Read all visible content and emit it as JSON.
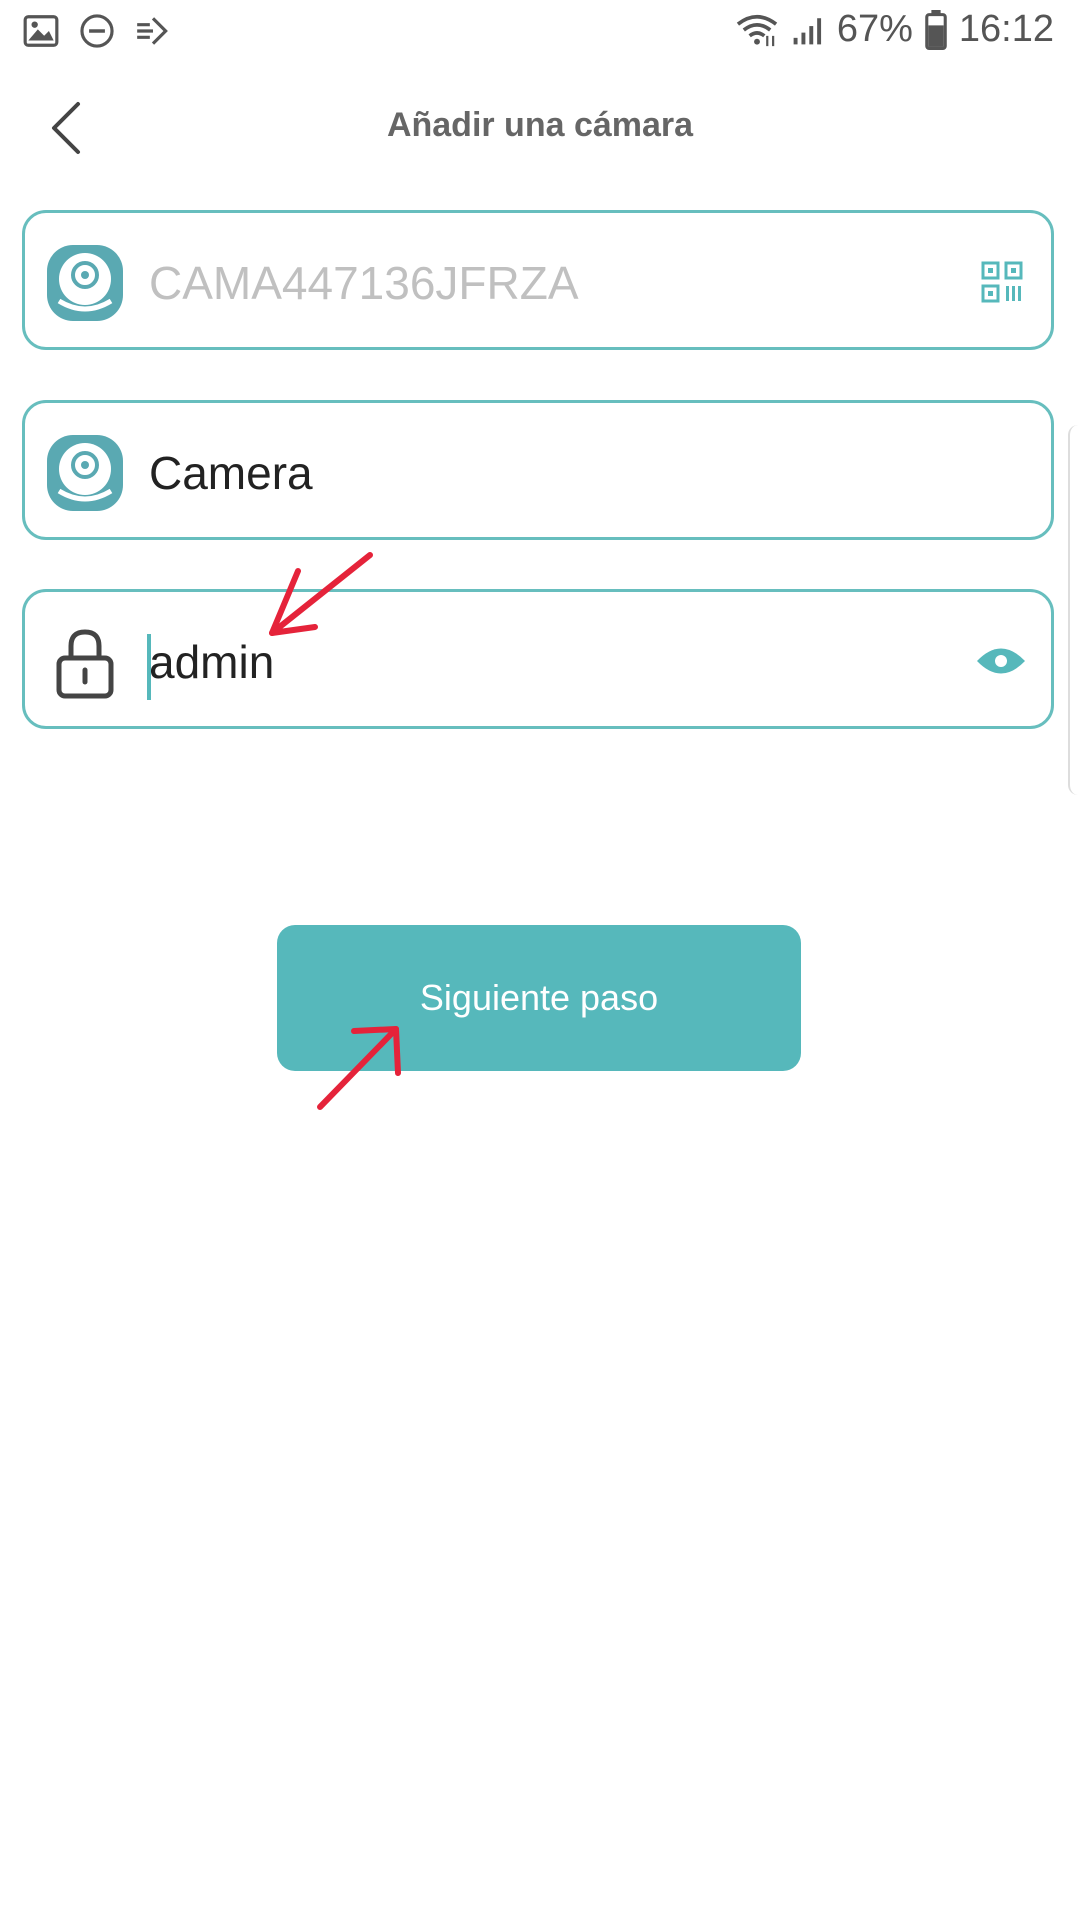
{
  "status_bar": {
    "battery": "67%",
    "time": "16:12"
  },
  "header": {
    "title": "Añadir una cámara"
  },
  "fields": {
    "device_id": {
      "value": "CAMA447136JFRZA"
    },
    "camera_name": {
      "value": "Camera"
    },
    "password": {
      "value": "admin"
    }
  },
  "actions": {
    "next_label": "Siguiente paso"
  },
  "colors": {
    "accent": "#56b8bb",
    "border": "#67bebe",
    "annotation": "#e5233a"
  },
  "icons": [
    "gallery-icon",
    "do-not-disturb-icon",
    "cast-icon",
    "wifi-icon",
    "signal-icon",
    "battery-icon",
    "back-arrow-icon",
    "camera-logo-icon",
    "qr-code-icon",
    "lock-icon",
    "eye-icon"
  ]
}
